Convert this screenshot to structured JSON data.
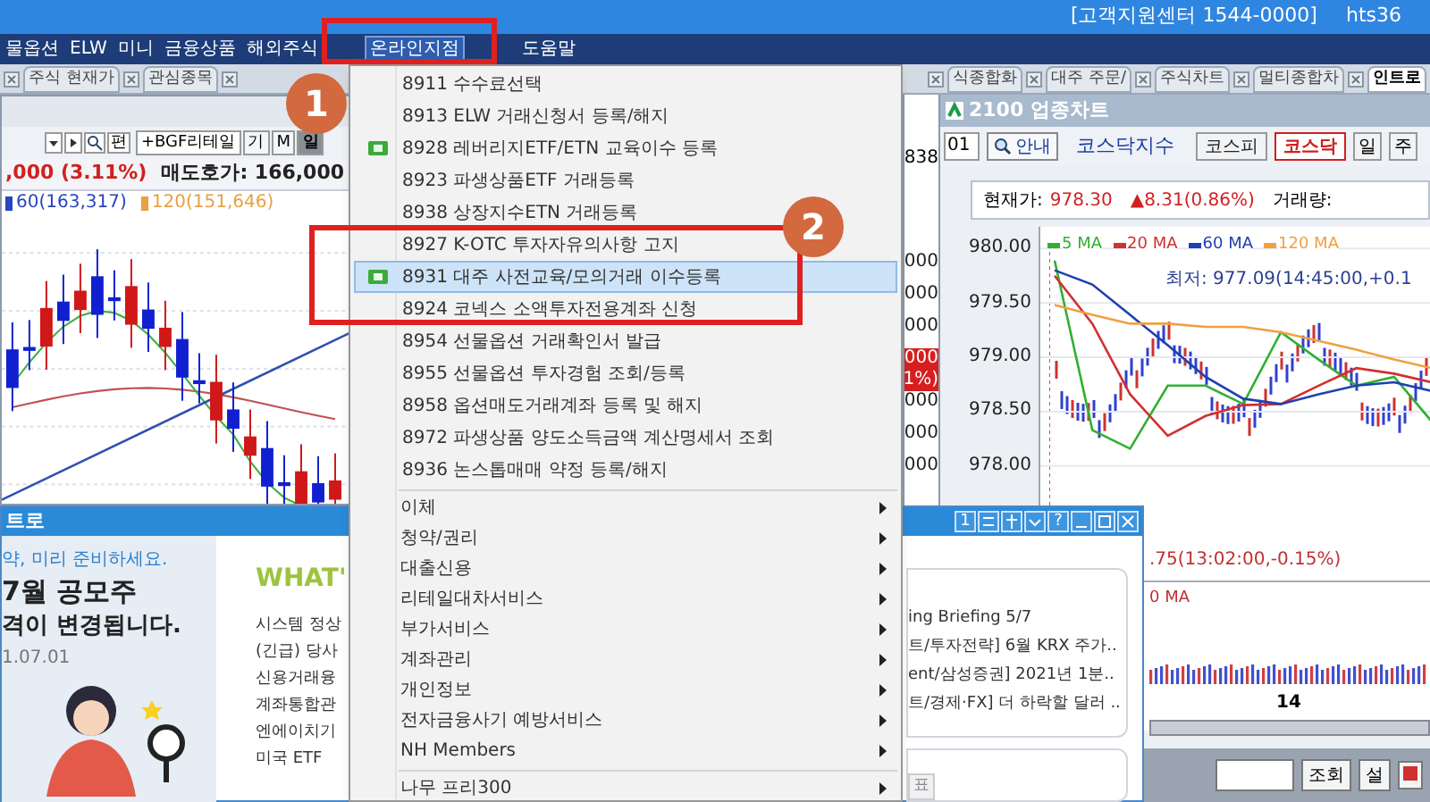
{
  "title_bar": {
    "support": "[고객지원센터 1544-0000]",
    "user": "hts36"
  },
  "menu_bar": [
    {
      "label": "물옵션",
      "selected": false
    },
    {
      "label": "ELW",
      "selected": false
    },
    {
      "label": "미니",
      "selected": false
    },
    {
      "label": "금융상품",
      "selected": false
    },
    {
      "label": "해외주식",
      "selected": false
    },
    {
      "label": "온라인지점",
      "selected": true
    },
    {
      "label": "도움말",
      "selected": false
    }
  ],
  "tabs_left": [
    {
      "label": "주식 현재가",
      "selected": false
    },
    {
      "label": "관심종목",
      "selected": false
    }
  ],
  "tabs_right": [
    {
      "label": "식종합화",
      "selected": false
    },
    {
      "label": "대주 주문/",
      "selected": false
    },
    {
      "label": "주식차트",
      "selected": false
    },
    {
      "label": "멀티종합차",
      "selected": false
    },
    {
      "label": "인트로",
      "selected": true
    }
  ],
  "stock_chart": {
    "edit_button": "편",
    "stock": "+BGF리테일",
    "buttons": [
      {
        "label": "기",
        "selected": false
      },
      {
        "label": "M",
        "selected": false
      },
      {
        "label": "일",
        "selected": true
      }
    ],
    "change": ",000 (3.11%)",
    "ask": "매도호가: 166,000",
    "legend": [
      {
        "label": "60(163,317)",
        "color": "#2a44c0"
      },
      {
        "label": "120(151,646)",
        "color": "#e8a040"
      }
    ]
  },
  "price_strip": {
    "code": "838",
    "cells": [
      {
        "text": "000",
        "highlighted": false
      },
      {
        "text": "000",
        "highlighted": false
      },
      {
        "text": "000",
        "highlighted": false
      },
      {
        "text": "000",
        "highlighted": true
      },
      {
        "text": "1%)",
        "highlighted": true
      },
      {
        "text": "000",
        "highlighted": false
      },
      {
        "text": "000",
        "highlighted": false
      },
      {
        "text": "000",
        "highlighted": false
      }
    ]
  },
  "right_chart": {
    "title": "2100 업종차트",
    "code": "01",
    "guide_button": "안내",
    "index_name": "코스닥지수",
    "markets": [
      {
        "label": "코스피",
        "selected": false
      },
      {
        "label": "코스닥",
        "selected": true
      }
    ],
    "periods": [
      {
        "label": "일",
        "selected": false
      },
      {
        "label": "주",
        "selected": false
      }
    ],
    "price_label": "현재가:",
    "price": "978.30",
    "change": "▲8.31(0.86%)",
    "volume_label": "거래량:",
    "chart_data": {
      "type": "line",
      "grid": true,
      "ylim": [
        977.21,
        980.2
      ],
      "yticks": [
        {
          "value": 980,
          "label": "980.00"
        },
        {
          "value": 979.5,
          "label": "979.50"
        },
        {
          "value": 979,
          "label": "979.00"
        },
        {
          "value": 978.5,
          "label": "978.50"
        },
        {
          "value": 978,
          "label": "978.00"
        }
      ],
      "series": [
        {
          "name": "5 MA",
          "color": "#30b030",
          "values": [
            979.89,
            978.33,
            978.16,
            978.74,
            978.74,
            978.57,
            979.23,
            978.98,
            978.74,
            978.82,
            978.41
          ]
        },
        {
          "name": "20 MA",
          "color": "#d03030",
          "values": [
            979.75,
            979.31,
            978.66,
            978.28,
            978.46,
            978.56,
            978.57,
            978.74,
            978.9,
            978.85,
            978.77
          ]
        },
        {
          "name": "60 MA",
          "color": "#2040b0",
          "values": [
            979.8,
            979.67,
            979.39,
            979.11,
            978.82,
            978.62,
            978.57,
            978.66,
            978.74,
            978.77,
            978.69
          ]
        },
        {
          "name": "120 MA",
          "color": "#f0a040",
          "values": [
            979.48,
            979.39,
            979.31,
            979.31,
            979.28,
            979.28,
            979.23,
            979.15,
            979.07,
            978.98,
            978.9
          ]
        }
      ]
    },
    "low_note": "최저: 977.09(14:45:00,+0.1",
    "high_note": ".75(13:02:00,-0.15%)",
    "volume_legend": "0 MA",
    "x_label": "14",
    "query_button": "조회",
    "settings_button": "설"
  },
  "intro_window": {
    "title": "트로",
    "banner": [
      "약, 미리 준비하세요.",
      "7월 공모주",
      "격이 변경됩니다.",
      "1.07.01"
    ],
    "what_heading": "WHAT'",
    "notices": [
      "시스템 정상",
      "(긴급) 당사",
      "신용거래융",
      "계좌통합관",
      "엔에이치기",
      "미국 ETF"
    ],
    "page_button": "1",
    "help_button": "?",
    "news": [
      "ing Briefing 5/7",
      "트/투자전략] 6월 KRX 주가..",
      "ent/삼성증권] 2021년 1분..",
      "트/경제·FX] 더 하락할 달러 .."
    ],
    "bottom_tab": "표"
  },
  "menu": {
    "items": [
      {
        "kind": "command",
        "label": "8911 수수료선택",
        "icon": false,
        "selected": false
      },
      {
        "kind": "command",
        "label": "8913 ELW 거래신청서 등록/해지",
        "icon": false,
        "selected": false
      },
      {
        "kind": "command",
        "label": "8928 레버리지ETF/ETN 교육이수 등록",
        "icon": true,
        "selected": false
      },
      {
        "kind": "command",
        "label": "8923 파생상품ETF 거래등록",
        "icon": false,
        "selected": false
      },
      {
        "kind": "command",
        "label": "8938 상장지수ETN 거래등록",
        "icon": false,
        "selected": false
      },
      {
        "kind": "command",
        "label": "8927 K-OTC 투자자유의사항 고지",
        "icon": false,
        "selected": false
      },
      {
        "kind": "command",
        "label": "8931 대주 사전교육/모의거래 이수등록",
        "icon": true,
        "selected": true
      },
      {
        "kind": "command",
        "label": "8924 코넥스 소액투자전용계좌 신청",
        "icon": false,
        "selected": false
      },
      {
        "kind": "command",
        "label": "8954 선물옵션 거래확인서 발급",
        "icon": false,
        "selected": false
      },
      {
        "kind": "command",
        "label": "8955 선물옵션 투자경험 조회/등록",
        "icon": false,
        "selected": false
      },
      {
        "kind": "command",
        "label": "8958 옵션매도거래계좌 등록 및 해지",
        "icon": false,
        "selected": false
      },
      {
        "kind": "command",
        "label": "8972 파생상품 양도소득금액 계산명세서 조회",
        "icon": false,
        "selected": false
      },
      {
        "kind": "command",
        "label": "8936 논스톱매매 약정 등록/해지",
        "icon": false,
        "selected": false
      },
      {
        "kind": "separator"
      },
      {
        "kind": "submenu",
        "label": "이체"
      },
      {
        "kind": "submenu",
        "label": "청약/권리"
      },
      {
        "kind": "submenu",
        "label": "대출신용"
      },
      {
        "kind": "submenu",
        "label": "리테일대차서비스"
      },
      {
        "kind": "submenu",
        "label": "부가서비스"
      },
      {
        "kind": "submenu",
        "label": "계좌관리"
      },
      {
        "kind": "submenu",
        "label": "개인정보"
      },
      {
        "kind": "submenu",
        "label": "전자금융사기 예방서비스"
      },
      {
        "kind": "submenu",
        "label": "NH Members"
      },
      {
        "kind": "separator"
      },
      {
        "kind": "submenu",
        "label": "나무 프리300"
      }
    ]
  },
  "annotations": [
    {
      "label": "1"
    },
    {
      "label": "2"
    }
  ]
}
